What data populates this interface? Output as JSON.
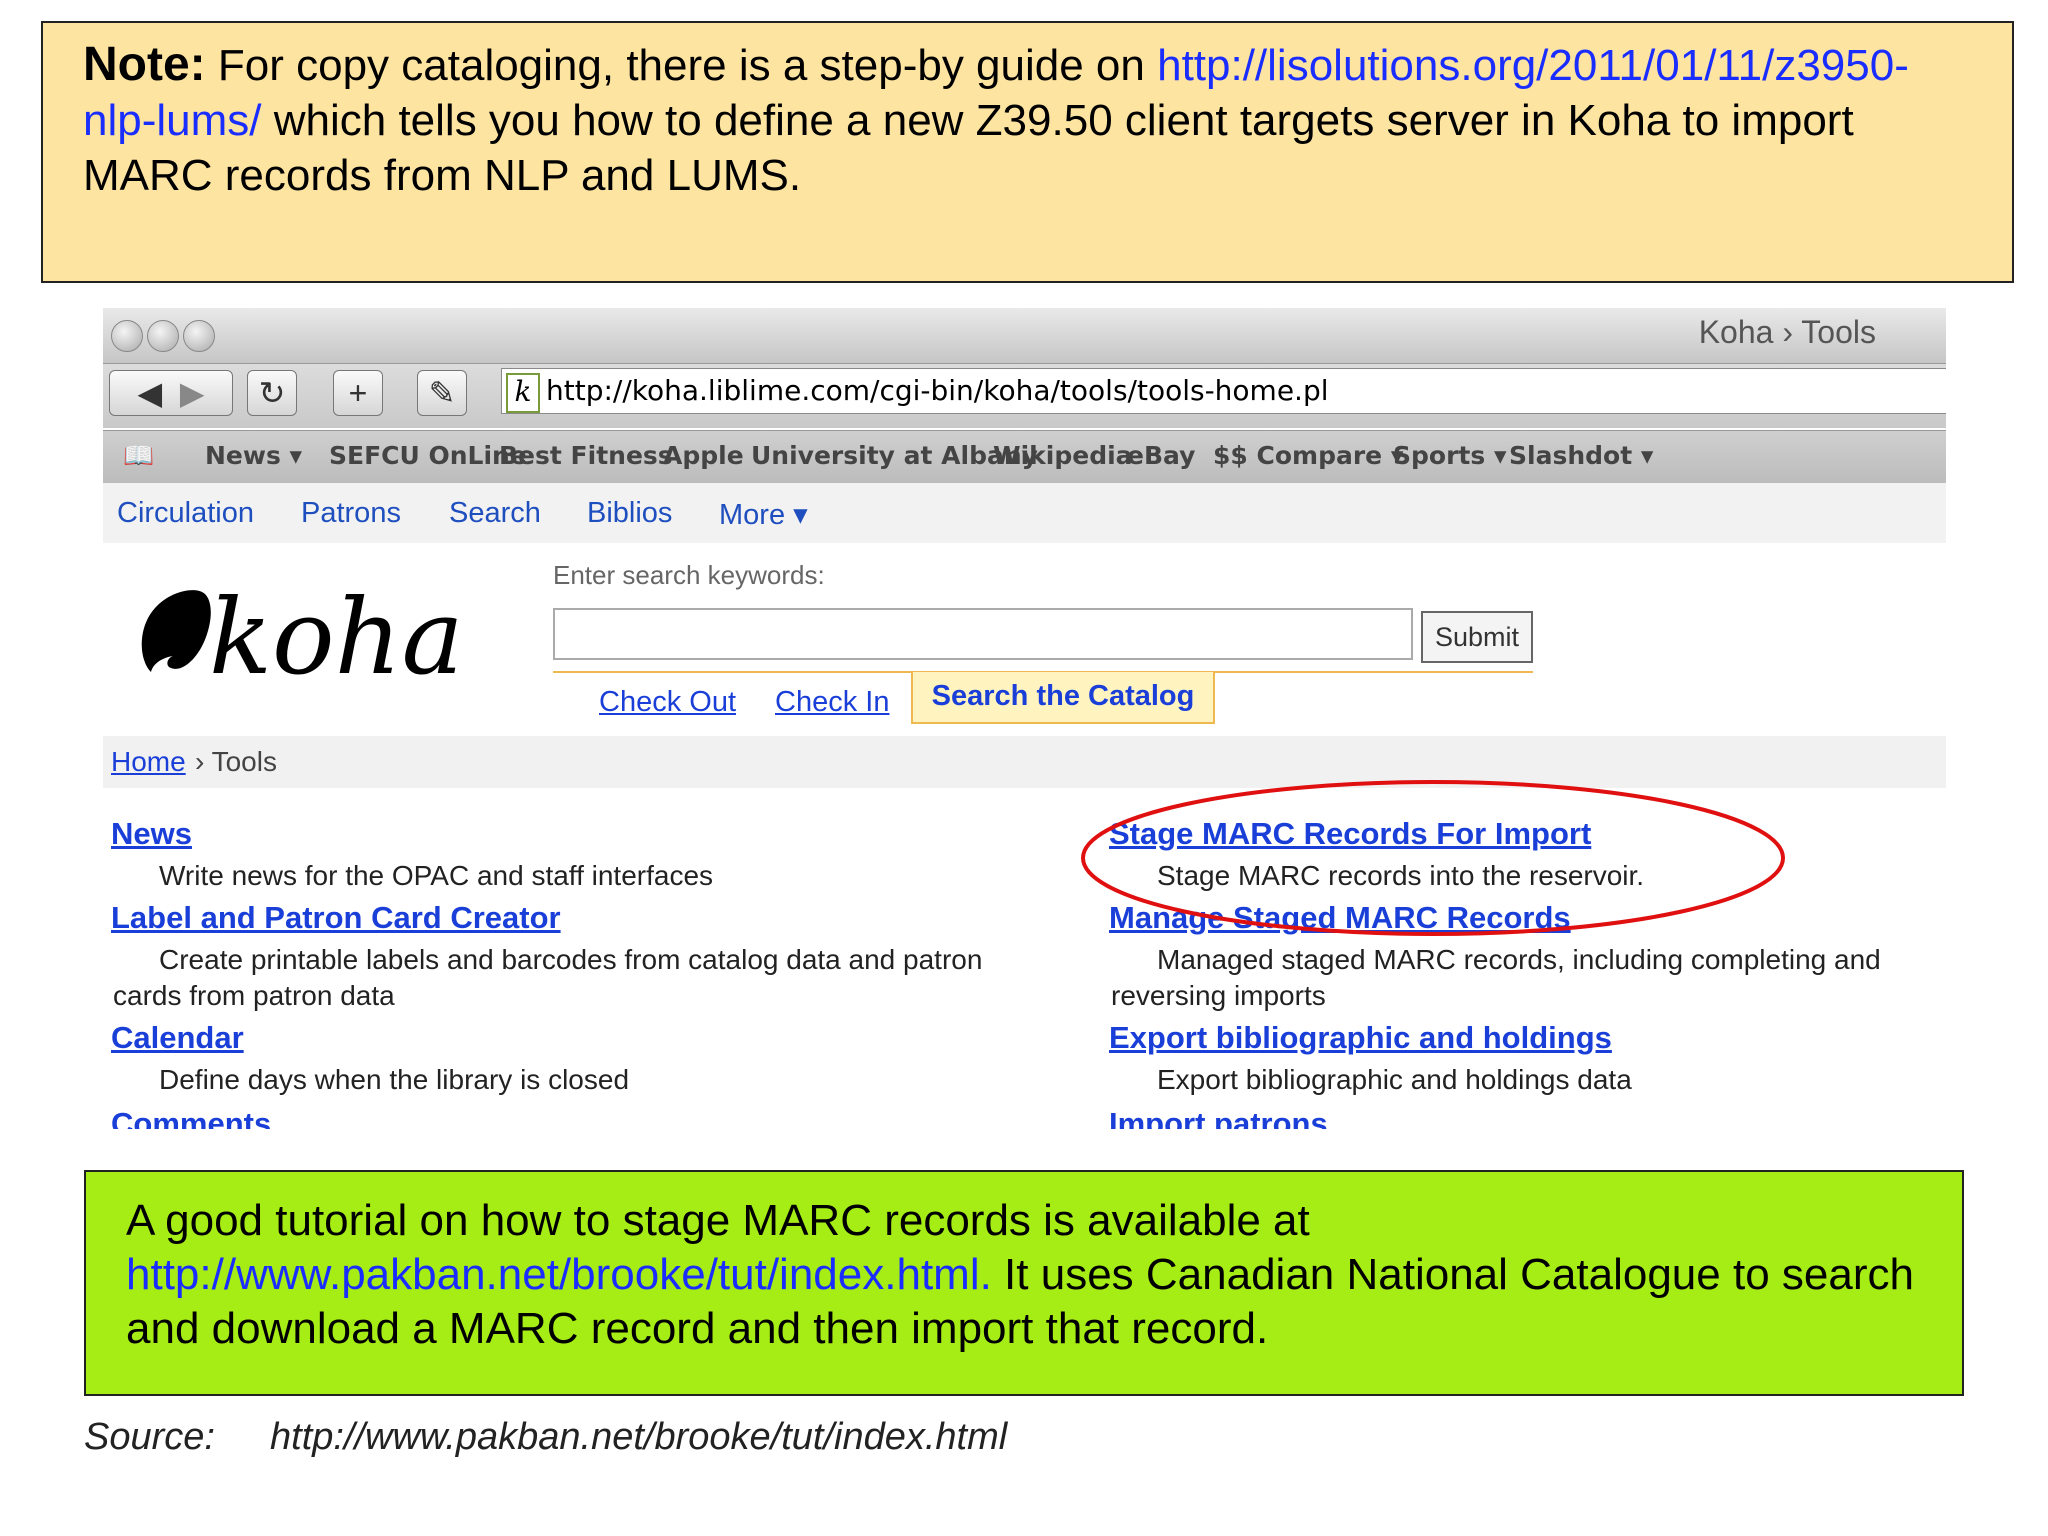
{
  "note": {
    "label": "Note:",
    "text_before": " For copy cataloging, there is a step-by guide on ",
    "url": "http://lisolutions.org/2011/01/11/z3950-nlp-lums/",
    "text_after": "  which tells you how to define a new Z39.50 client targets server in Koha to import MARC records from NLP and LUMS."
  },
  "browser": {
    "window_title": "Koha › Tools",
    "url": "http://koha.liblime.com/cgi-bin/koha/tools/tools-home.pl",
    "bookmarks": [
      "News ▾",
      "SEFCU OnLine",
      "Best Fitness",
      "Apple",
      "University at Albany",
      "Wikipedia",
      "eBay",
      "$$ Compare ▾",
      "Sports ▾",
      "Slashdot ▾"
    ]
  },
  "koha": {
    "nav": [
      "Circulation",
      "Patrons",
      "Search",
      "Biblios",
      "More ▾"
    ],
    "logo_text": "koha",
    "search_label": "Enter search keywords:",
    "submit_label": "Submit",
    "tabs": [
      "Check Out",
      "Check In",
      "Search the Catalog"
    ],
    "breadcrumb": {
      "home": "Home",
      "current": "› Tools"
    },
    "left_tools": [
      {
        "title": "News",
        "desc": "Write news for the OPAC and staff interfaces"
      },
      {
        "title": "Label and Patron Card Creator",
        "desc": "Create printable labels and barcodes from catalog data and patron cards from patron data"
      },
      {
        "title": "Calendar",
        "desc": "Define days when the library is closed"
      },
      {
        "title": "Comments",
        "desc": ""
      }
    ],
    "right_tools": [
      {
        "title": "Stage MARC Records For Import",
        "desc": "Stage MARC records into the reservoir."
      },
      {
        "title": "Manage Staged MARC Records",
        "desc": "Managed staged MARC records, including completing and reversing imports"
      },
      {
        "title": "Export bibliographic and holdings",
        "desc": "Export bibliographic and holdings data"
      },
      {
        "title": "Import patrons",
        "desc": ""
      }
    ],
    "highlight_color": "#e01010"
  },
  "tutorial": {
    "text_before": "A good tutorial on how to stage MARC records is available at ",
    "url": "http://www.pakban.net/brooke/tut/index.html.",
    "text_after": " It uses Canadian National Catalogue to search and download a MARC record and then import that record."
  },
  "source": {
    "label": "Source:",
    "url": "http://www.pakban.net/brooke/tut/index.html"
  }
}
